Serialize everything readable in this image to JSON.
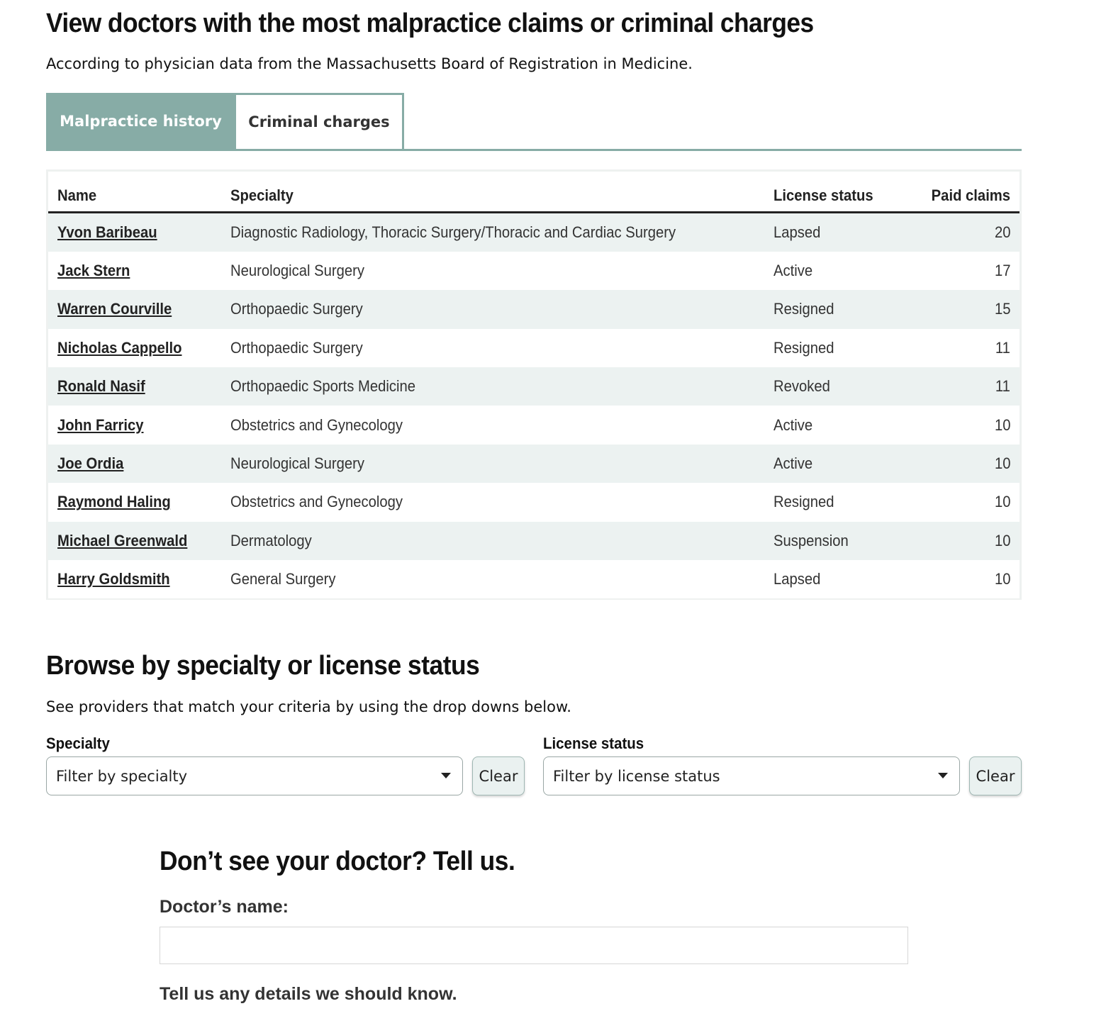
{
  "header": {
    "title": "View doctors with the most malpractice claims or criminal charges",
    "subtitle": "According to physician data from the Massachusetts Board of Registration in Medicine."
  },
  "tabs": [
    {
      "label": "Malpractice history",
      "active": true
    },
    {
      "label": "Criminal charges",
      "active": false
    }
  ],
  "table": {
    "columns": [
      "Name",
      "Specialty",
      "License status",
      "Paid claims"
    ],
    "rows": [
      {
        "name": "Yvon Baribeau",
        "specialty": "Diagnostic Radiology, Thoracic Surgery/Thoracic and Cardiac Surgery",
        "status": "Lapsed",
        "claims": "20"
      },
      {
        "name": "Jack Stern",
        "specialty": "Neurological Surgery",
        "status": "Active",
        "claims": "17"
      },
      {
        "name": "Warren Courville",
        "specialty": "Orthopaedic Surgery",
        "status": "Resigned",
        "claims": "15"
      },
      {
        "name": "Nicholas Cappello",
        "specialty": "Orthopaedic Surgery",
        "status": "Resigned",
        "claims": "11"
      },
      {
        "name": "Ronald Nasif",
        "specialty": "Orthopaedic Sports Medicine",
        "status": "Revoked",
        "claims": "11"
      },
      {
        "name": "John Farricy",
        "specialty": "Obstetrics and Gynecology",
        "status": "Active",
        "claims": "10"
      },
      {
        "name": "Joe Ordia",
        "specialty": "Neurological Surgery",
        "status": "Active",
        "claims": "10"
      },
      {
        "name": "Raymond Haling",
        "specialty": "Obstetrics and Gynecology",
        "status": "Resigned",
        "claims": "10"
      },
      {
        "name": "Michael Greenwald",
        "specialty": "Dermatology",
        "status": "Suspension",
        "claims": "10"
      },
      {
        "name": "Harry Goldsmith",
        "specialty": "General Surgery",
        "status": "Lapsed",
        "claims": "10"
      }
    ]
  },
  "browse": {
    "title": "Browse by specialty or license status",
    "description": "See providers that match your criteria by using the drop downs below.",
    "specialty_label": "Specialty",
    "specialty_placeholder": "Filter by specialty",
    "status_label": "License status",
    "status_placeholder": "Filter by license status",
    "clear_label": "Clear"
  },
  "tell_us": {
    "title": "Don’t see your doctor? Tell us.",
    "name_label": "Doctor’s name:",
    "name_value": "",
    "details_label": "Tell us any details we should know."
  },
  "colors": {
    "accent": "#87aca6",
    "row_stripe": "#ecf2f1",
    "text": "#111111"
  },
  "icons": {
    "dropdown": "caret-down-icon"
  }
}
